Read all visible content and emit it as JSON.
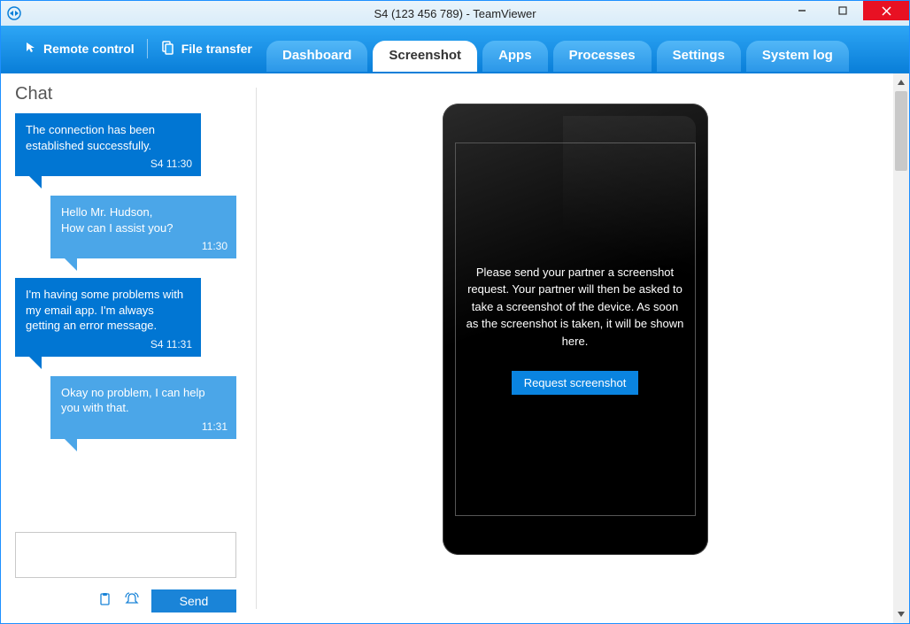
{
  "window": {
    "title": "S4 (123 456 789) - TeamViewer"
  },
  "menubar": {
    "remote_control": "Remote control",
    "file_transfer": "File transfer"
  },
  "tabs": {
    "dashboard": "Dashboard",
    "screenshot": "Screenshot",
    "apps": "Apps",
    "processes": "Processes",
    "settings": "Settings",
    "system_log": "System log"
  },
  "chat": {
    "title": "Chat",
    "messages": [
      {
        "text": "The connection has been established successfully.",
        "meta": "S4 11:30",
        "tone": "dark"
      },
      {
        "text": "Hello Mr. Hudson,\nHow can I assist you?",
        "meta": "11:30",
        "tone": "light"
      },
      {
        "text": "I'm having some problems with my email app. I'm always getting an error message.",
        "meta": "S4 11:31",
        "tone": "dark"
      },
      {
        "text": "Okay no problem, I can help you with that.",
        "meta": "11:31",
        "tone": "light"
      }
    ],
    "send_label": "Send"
  },
  "device": {
    "instruction": "Please send your partner a screenshot request. Your partner will then be asked to take a screenshot of the device. As soon as the screenshot is taken, it will be shown here.",
    "request_label": "Request screenshot"
  }
}
